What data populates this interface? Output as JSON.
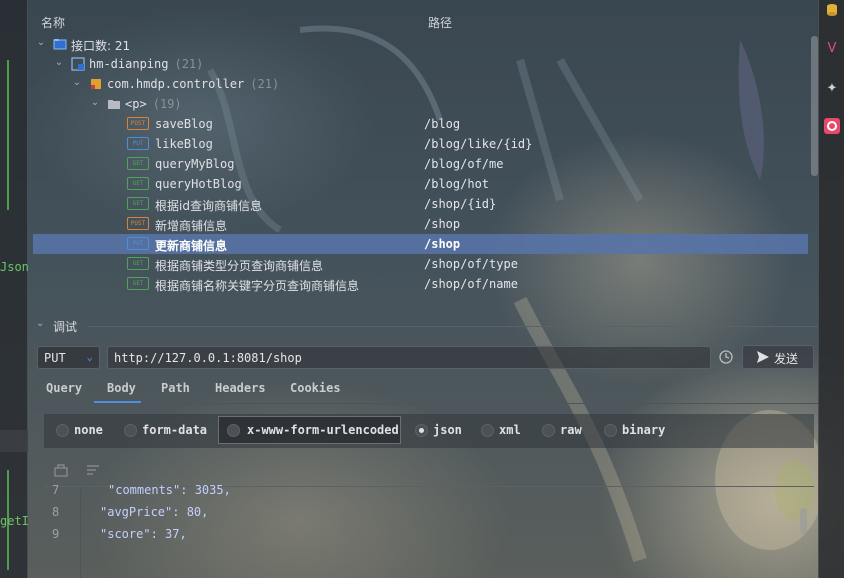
{
  "header": {
    "col_name": "名称",
    "col_path": "路径"
  },
  "tree": {
    "root": {
      "label": "接口数: 21"
    },
    "module": {
      "label": "hm-dianping",
      "count": "(21)"
    },
    "package": {
      "label": "com.hmdp.controller",
      "count": "(21)"
    },
    "folder": {
      "label": "<p>",
      "count": "(19)"
    },
    "endpoints": [
      {
        "method": "POST",
        "name": "saveBlog",
        "path": "/blog"
      },
      {
        "method": "PUT",
        "name": "likeBlog",
        "path": "/blog/like/{id}"
      },
      {
        "method": "GET",
        "name": "queryMyBlog",
        "path": "/blog/of/me"
      },
      {
        "method": "GET",
        "name": "queryHotBlog",
        "path": "/blog/hot"
      },
      {
        "method": "GET",
        "name": "根据id查询商铺信息",
        "path": "/shop/{id}"
      },
      {
        "method": "POST",
        "name": "新增商铺信息",
        "path": "/shop"
      },
      {
        "method": "PUT",
        "name": "更新商铺信息",
        "path": "/shop",
        "selected": true
      },
      {
        "method": "GET",
        "name": "根据商铺类型分页查询商铺信息",
        "path": "/shop/of/type"
      },
      {
        "method": "GET",
        "name": "根据商铺名称关键字分页查询商铺信息",
        "path": "/shop/of/name"
      }
    ]
  },
  "debug": {
    "section_label": "调试",
    "method": "PUT",
    "url": "http://127.0.0.1:8081/shop",
    "send_label": "发送",
    "tabs": [
      "Query",
      "Body",
      "Path",
      "Headers",
      "Cookies"
    ],
    "active_tab": "Body",
    "body_types": [
      "none",
      "form-data",
      "x-www-form-urlencoded",
      "json",
      "xml",
      "raw",
      "binary"
    ],
    "selected_body_type": "json"
  },
  "editor": {
    "lines": [
      {
        "num": "7",
        "text": "\"comments\": 3035,"
      },
      {
        "num": "8",
        "text": "\"avgPrice\": 80,"
      },
      {
        "num": "9",
        "text": "\"score\": 37,"
      }
    ]
  },
  "left_strip": {
    "frag1": "Json",
    "frag2": "getI"
  },
  "colors": {
    "selected_row": "#5874a8",
    "accent": "#4f8ed8",
    "post": "#d9843b",
    "put": "#4a8fd8",
    "get": "#4fa35a"
  }
}
